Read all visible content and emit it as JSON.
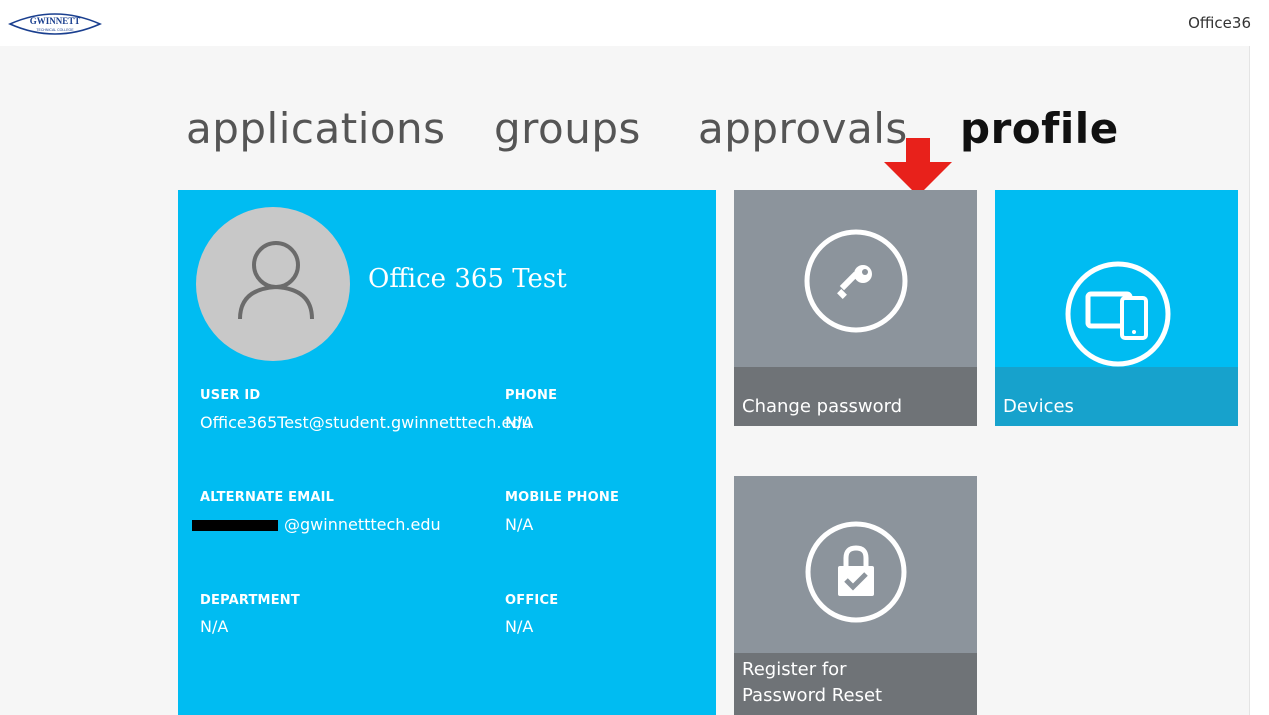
{
  "header": {
    "logo_text": "GWINNETT",
    "logo_subtext": "TECHNICAL COLLEGE",
    "user_label": "Office36"
  },
  "nav": {
    "tabs": [
      {
        "label": "applications",
        "active": false
      },
      {
        "label": "groups",
        "active": false
      },
      {
        "label": "approvals",
        "active": false
      },
      {
        "label": "profile",
        "active": true
      }
    ]
  },
  "profile": {
    "display_name": "Office 365 Test",
    "fields": {
      "user_id_label": "USER ID",
      "user_id_value": "Office365Test@student.gwinnetttech.edu",
      "phone_label": "PHONE",
      "phone_value": "N/A",
      "alternate_email_label": "ALTERNATE EMAIL",
      "alternate_email_value": "@gwinnetttech.edu",
      "mobile_phone_label": "MOBILE PHONE",
      "mobile_phone_value": "N/A",
      "department_label": "DEPARTMENT",
      "department_value": "N/A",
      "office_label": "OFFICE",
      "office_value": "N/A"
    }
  },
  "tiles": {
    "change_password": {
      "label": "Change password",
      "icon": "key-icon"
    },
    "devices": {
      "label": "Devices",
      "icon": "devices-icon"
    },
    "register_reset": {
      "label_line1": "Register for",
      "label_line2": "Password Reset",
      "icon": "lock-check-icon"
    }
  },
  "colors": {
    "accent_blue": "#00bcf2",
    "tile_gray": "#8c949c",
    "tile_gray_footer": "#6f7377",
    "arrow_red": "#e8211b"
  }
}
